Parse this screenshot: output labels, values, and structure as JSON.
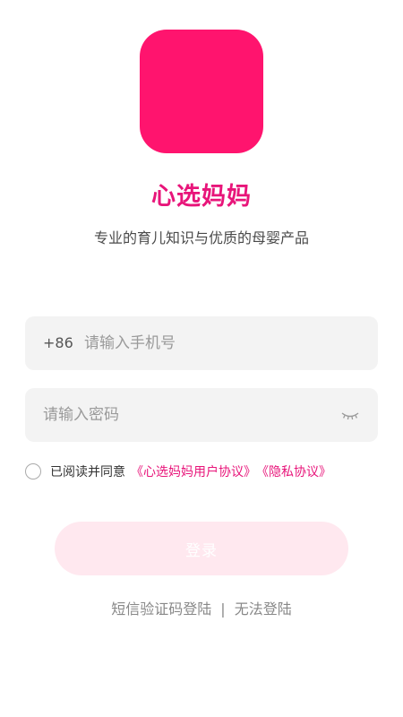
{
  "app": {
    "name": "心选妈妈",
    "slogan": "专业的育儿知识与优质的母婴产品",
    "brand_color": "#FF146E",
    "accent_color": "#E8157A"
  },
  "login_form": {
    "phone": {
      "country_code": "+86",
      "placeholder": "请输入手机号",
      "value": ""
    },
    "password": {
      "placeholder": "请输入密码",
      "value": "",
      "toggle_icon": "eye-closed-icon"
    },
    "agreement": {
      "checked": false,
      "text": "已阅读并同意",
      "user_agreement": "《心选妈妈用户协议》",
      "privacy_policy": "《隐私协议》"
    },
    "login_label": "登录"
  },
  "alt_links": {
    "sms_login": "短信验证码登陆",
    "separator": "|",
    "cannot_login": "无法登陆"
  }
}
